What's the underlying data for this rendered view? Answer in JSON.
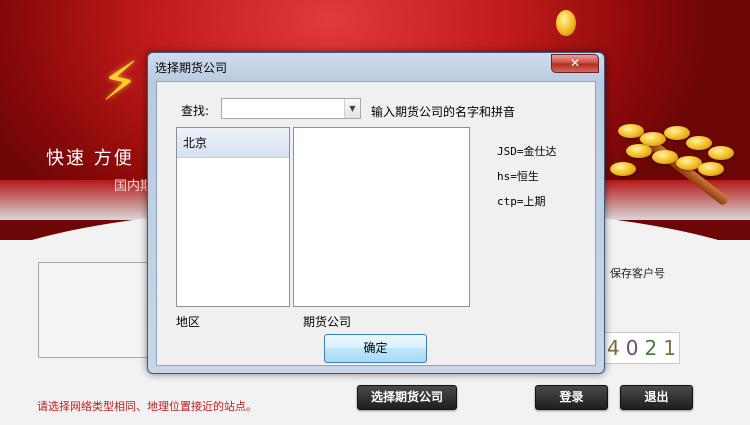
{
  "background": {
    "slogan": "快速 方便",
    "subslogan": "国内期",
    "save_account_label": "保存客户号",
    "captcha": [
      "4",
      "0",
      "2",
      "1"
    ],
    "hint": "请选择网络类型相同、地理位置接近的站点。",
    "select_company_button": "选择期货公司",
    "login_button": "登录",
    "exit_button": "退出"
  },
  "dialog": {
    "title": "选择期货公司",
    "close_symbol": "✕",
    "search_label": "查找:",
    "search_value": "",
    "search_hint": "输入期货公司的名字和拼音",
    "regions": [
      "北京"
    ],
    "companies": [],
    "region_label": "地区",
    "company_label": "期货公司",
    "legend": [
      "JSD=金仕达",
      "hs=恒生",
      "ctp=上期"
    ],
    "ok_button": "确定"
  },
  "colors": {
    "banner_red": "#c41c1c",
    "hint_red": "#c02020",
    "dark_button": "#2a2a2a",
    "close_red": "#c8473c"
  }
}
